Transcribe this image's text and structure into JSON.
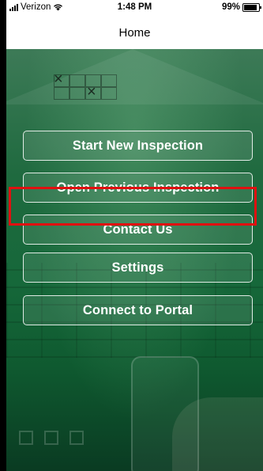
{
  "status_bar": {
    "carrier": "Verizon",
    "time": "1:48 PM",
    "battery": "99%"
  },
  "nav": {
    "title": "Home"
  },
  "menu": [
    {
      "label": "Start New Inspection"
    },
    {
      "label": "Open Previous Inspection"
    },
    {
      "label": "Contact Us"
    },
    {
      "label": "Settings"
    },
    {
      "label": "Connect to Portal"
    }
  ],
  "highlight": {
    "color": "#e01010",
    "target": "Settings"
  },
  "colors": {
    "background_green": "#16683a",
    "button_border": "#ffffff"
  },
  "icons": [
    "signal-icon",
    "wifi-icon",
    "battery-icon"
  ]
}
